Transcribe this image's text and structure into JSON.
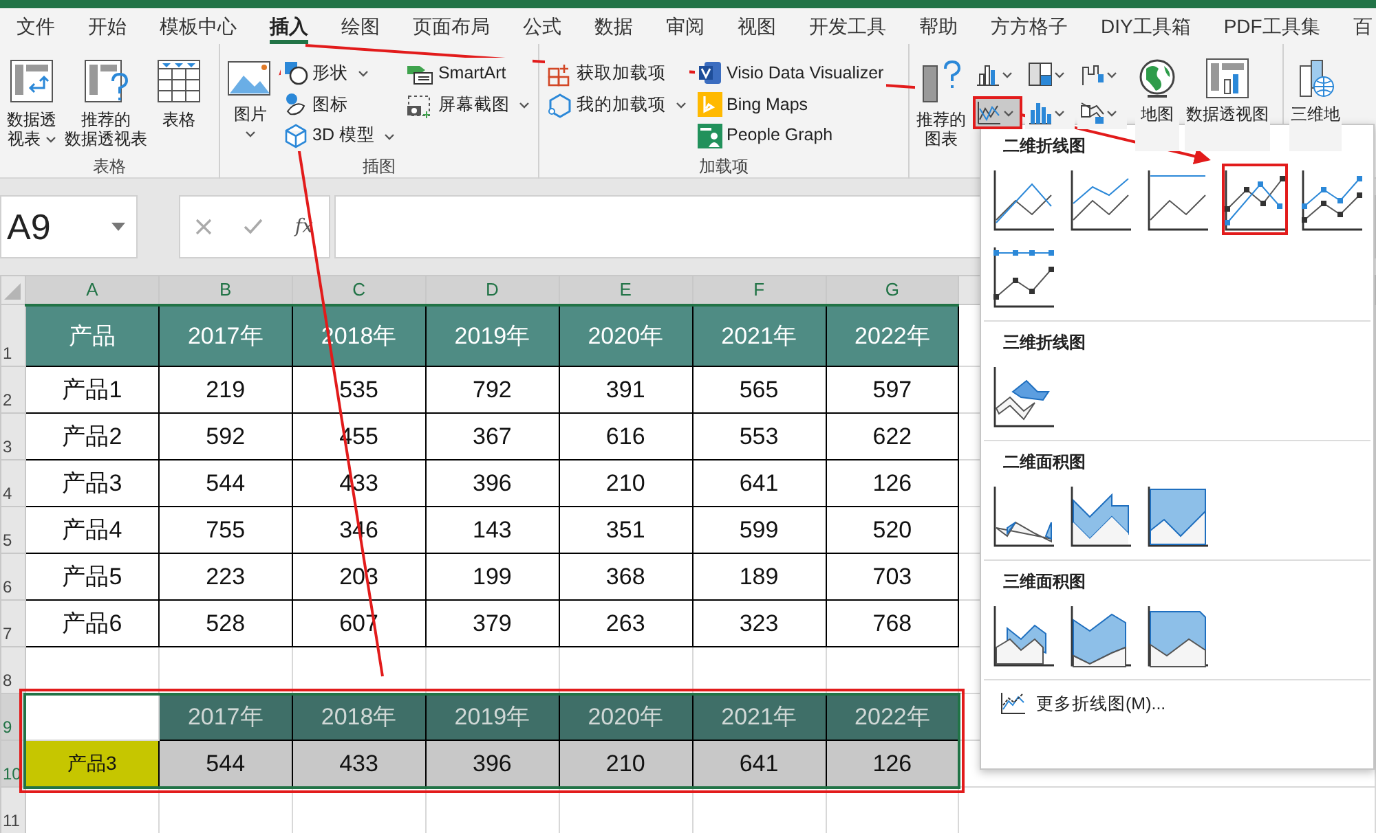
{
  "tabs": [
    {
      "label": "文件",
      "selected": false
    },
    {
      "label": "开始",
      "selected": false
    },
    {
      "label": "模板中心",
      "selected": false
    },
    {
      "label": "插入",
      "selected": true
    },
    {
      "label": "绘图",
      "selected": false
    },
    {
      "label": "页面布局",
      "selected": false
    },
    {
      "label": "公式",
      "selected": false
    },
    {
      "label": "数据",
      "selected": false
    },
    {
      "label": "审阅",
      "selected": false
    },
    {
      "label": "视图",
      "selected": false
    },
    {
      "label": "开发工具",
      "selected": false
    },
    {
      "label": "帮助",
      "selected": false
    },
    {
      "label": "方方格子",
      "selected": false
    },
    {
      "label": "DIY工具箱",
      "selected": false
    },
    {
      "label": "PDF工具集",
      "selected": false
    },
    {
      "label": "百",
      "selected": false
    }
  ],
  "ribbon": [
    {
      "label": "表格",
      "columns": [
        {
          "kind": "large",
          "lines": [
            "数据透",
            "视表"
          ],
          "dropdown": true
        },
        {
          "kind": "large",
          "lines": [
            "推荐的",
            "数据透视表"
          ]
        },
        {
          "kind": "large",
          "lines": [
            "表格"
          ]
        }
      ]
    },
    {
      "label": "插图",
      "columns": [
        {
          "kind": "large",
          "lines": [
            "图片"
          ],
          "dropdown": true
        },
        {
          "kind": "stack",
          "items": [
            {
              "text": "形状",
              "dropdown": true
            },
            {
              "text": "图标",
              "dropdown": false
            },
            {
              "text": "3D 模型",
              "dropdown": true
            }
          ]
        },
        {
          "kind": "stack",
          "items": [
            {
              "text": "SmartArt",
              "dropdown": false
            },
            {
              "text": "屏幕截图",
              "dropdown": true
            }
          ]
        }
      ]
    },
    {
      "label": "加载项",
      "columns": [
        {
          "kind": "stack",
          "items": [
            {
              "text": "获取加载项",
              "dropdown": false
            },
            {
              "text": "我的加载项",
              "dropdown": true
            }
          ]
        },
        {
          "kind": "stack",
          "items": [
            {
              "text": "Visio Data Visualizer",
              "dropdown": false
            },
            {
              "text": "Bing Maps",
              "dropdown": false
            },
            {
              "text": "People Graph",
              "dropdown": false
            }
          ]
        }
      ]
    },
    {
      "columns": [
        {
          "kind": "large",
          "lines": [
            "推荐的",
            "图表"
          ]
        },
        {
          "kind": "grid",
          "items": [
            {
              "dropdown": true,
              "selected": false
            },
            {
              "dropdown": true,
              "selected": false
            },
            {
              "dropdown": true,
              "selected": false
            },
            {
              "dropdown": true,
              "selected": true
            },
            {
              "dropdown": true,
              "selected": false
            },
            {
              "dropdown": true,
              "selected": false
            }
          ]
        },
        {
          "kind": "large",
          "lines": [
            "地图"
          ]
        },
        {
          "kind": "large",
          "lines": [
            "数据透视图"
          ]
        }
      ]
    },
    {
      "columns": [
        {
          "kind": "large",
          "lines": [
            "三维地"
          ]
        }
      ]
    }
  ],
  "name_box": "A9",
  "function_label": "fx",
  "columns": [
    {
      "label": "A",
      "selected": true
    },
    {
      "label": "B",
      "selected": true
    },
    {
      "label": "C",
      "selected": true
    },
    {
      "label": "D",
      "selected": true
    },
    {
      "label": "E",
      "selected": true
    },
    {
      "label": "F",
      "selected": true
    },
    {
      "label": "G",
      "selected": true
    }
  ],
  "rows": [
    {
      "label": "1",
      "selected": false,
      "cells": [
        {
          "kind": "head",
          "text": "产品"
        },
        {
          "kind": "head",
          "text": "2017年"
        },
        {
          "kind": "head",
          "text": "2018年"
        },
        {
          "kind": "head",
          "text": "2019年"
        },
        {
          "kind": "head",
          "text": "2020年"
        },
        {
          "kind": "head",
          "text": "2021年"
        },
        {
          "kind": "head",
          "text": "2022年"
        }
      ]
    },
    {
      "label": "2",
      "selected": false,
      "cells": [
        {
          "kind": "data",
          "text": "产品1"
        },
        {
          "kind": "data",
          "text": "219"
        },
        {
          "kind": "data",
          "text": "535"
        },
        {
          "kind": "data",
          "text": "792"
        },
        {
          "kind": "data",
          "text": "391"
        },
        {
          "kind": "data",
          "text": "565"
        },
        {
          "kind": "data",
          "text": "597"
        }
      ]
    },
    {
      "label": "3",
      "selected": false,
      "cells": [
        {
          "kind": "data",
          "text": "产品2"
        },
        {
          "kind": "data",
          "text": "592"
        },
        {
          "kind": "data",
          "text": "455"
        },
        {
          "kind": "data",
          "text": "367"
        },
        {
          "kind": "data",
          "text": "616"
        },
        {
          "kind": "data",
          "text": "553"
        },
        {
          "kind": "data",
          "text": "622"
        }
      ]
    },
    {
      "label": "4",
      "selected": false,
      "cells": [
        {
          "kind": "data",
          "text": "产品3"
        },
        {
          "kind": "data",
          "text": "544"
        },
        {
          "kind": "data",
          "text": "433"
        },
        {
          "kind": "data",
          "text": "396"
        },
        {
          "kind": "data",
          "text": "210"
        },
        {
          "kind": "data",
          "text": "641"
        },
        {
          "kind": "data",
          "text": "126"
        }
      ]
    },
    {
      "label": "5",
      "selected": false,
      "cells": [
        {
          "kind": "data",
          "text": "产品4"
        },
        {
          "kind": "data",
          "text": "755"
        },
        {
          "kind": "data",
          "text": "346"
        },
        {
          "kind": "data",
          "text": "143"
        },
        {
          "kind": "data",
          "text": "351"
        },
        {
          "kind": "data",
          "text": "599"
        },
        {
          "kind": "data",
          "text": "520"
        }
      ]
    },
    {
      "label": "6",
      "selected": false,
      "cells": [
        {
          "kind": "data",
          "text": "产品5"
        },
        {
          "kind": "data",
          "text": "223"
        },
        {
          "kind": "data",
          "text": "203"
        },
        {
          "kind": "data",
          "text": "199"
        },
        {
          "kind": "data",
          "text": "368"
        },
        {
          "kind": "data",
          "text": "189"
        },
        {
          "kind": "data",
          "text": "703"
        }
      ]
    },
    {
      "label": "7",
      "selected": false,
      "cells": [
        {
          "kind": "data",
          "text": "产品6"
        },
        {
          "kind": "data",
          "text": "528"
        },
        {
          "kind": "data",
          "text": "607"
        },
        {
          "kind": "data",
          "text": "379"
        },
        {
          "kind": "data",
          "text": "263"
        },
        {
          "kind": "data",
          "text": "323"
        },
        {
          "kind": "data",
          "text": "768"
        }
      ]
    },
    {
      "label": "8",
      "selected": false
    },
    {
      "label": "9",
      "selected": true,
      "cells": [
        {
          "kind": "blank"
        },
        {
          "kind": "head2",
          "text": "2017年"
        },
        {
          "kind": "head2",
          "text": "2018年"
        },
        {
          "kind": "head2",
          "text": "2019年"
        },
        {
          "kind": "head2",
          "text": "2020年"
        },
        {
          "kind": "head2",
          "text": "2021年"
        },
        {
          "kind": "head2",
          "text": "2022年"
        }
      ]
    },
    {
      "label": "10",
      "selected": true,
      "cells": [
        {
          "kind": "tag",
          "text": "产品3"
        },
        {
          "kind": "shade",
          "text": "544"
        },
        {
          "kind": "shade",
          "text": "433"
        },
        {
          "kind": "shade",
          "text": "396"
        },
        {
          "kind": "shade",
          "text": "210"
        },
        {
          "kind": "shade",
          "text": "641"
        },
        {
          "kind": "shade",
          "text": "126"
        }
      ]
    },
    {
      "label": "11",
      "selected": false
    }
  ],
  "line_gallery": {
    "sections": [
      {
        "title": "二维折线图",
        "items": [
          {
            "kind": "line",
            "selected": false
          },
          {
            "kind": "stacked-line",
            "selected": false
          },
          {
            "kind": "percent-line",
            "selected": false
          },
          {
            "kind": "line-markers",
            "selected": true
          },
          {
            "kind": "stacked-line-markers",
            "selected": false
          },
          {
            "kind": "percent-line-markers",
            "selected": false
          }
        ]
      },
      {
        "title": "三维折线图",
        "items": [
          {
            "kind": "line-3d",
            "selected": false
          }
        ]
      },
      {
        "title": "二维面积图",
        "items": [
          {
            "kind": "area",
            "selected": false
          },
          {
            "kind": "stacked-area",
            "selected": false
          },
          {
            "kind": "percent-area",
            "selected": false
          }
        ]
      },
      {
        "title": "三维面积图",
        "items": [
          {
            "kind": "area-3d",
            "selected": false
          },
          {
            "kind": "stacked-area-3d",
            "selected": false
          },
          {
            "kind": "percent-area-3d",
            "selected": false
          }
        ]
      }
    ],
    "more": "更多折线图(M)..."
  }
}
